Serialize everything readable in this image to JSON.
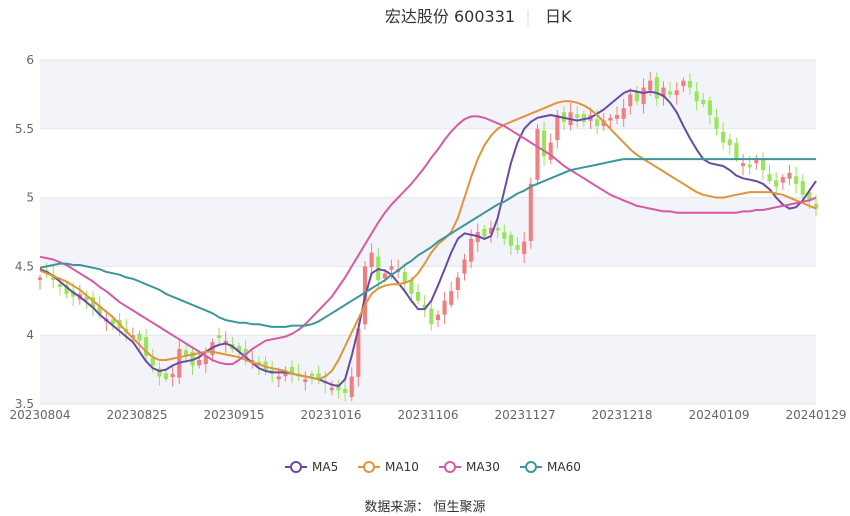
{
  "header": {
    "title": "宏达股份 600331",
    "period": "日K"
  },
  "legend": [
    {
      "name": "MA5",
      "color": "#6a4aa5"
    },
    {
      "name": "MA10",
      "color": "#e0953a"
    },
    {
      "name": "MA30",
      "color": "#d65aa6"
    },
    {
      "name": "MA60",
      "color": "#3d969a"
    }
  ],
  "footer": {
    "source": "数据来源：  恒生聚源"
  },
  "colors": {
    "up": "#f08080",
    "down": "#98e45a",
    "band": "#f3f4f9",
    "grid": "#e6e6e6"
  },
  "chart_data": {
    "type": "candlestick",
    "title": "宏达股份 600331",
    "ylim": [
      3.5,
      6
    ],
    "y_ticks": [
      3.5,
      4,
      4.5,
      5,
      5.5,
      6
    ],
    "x_tick_labels": [
      "20230804",
      "20230825",
      "20230915",
      "20231016",
      "20231106",
      "20231127",
      "20231218",
      "20240109",
      "20240129"
    ],
    "n_days": 118,
    "candle_close": [
      4.42,
      4.45,
      4.4,
      4.35,
      4.3,
      4.28,
      4.3,
      4.25,
      4.2,
      4.15,
      4.12,
      4.08,
      4.05,
      4.02,
      4.0,
      3.96,
      3.85,
      3.78,
      3.7,
      3.68,
      3.72,
      3.9,
      3.85,
      3.78,
      3.82,
      3.85,
      3.95,
      3.98,
      3.96,
      3.9,
      3.88,
      3.84,
      3.82,
      3.78,
      3.74,
      3.72,
      3.7,
      3.74,
      3.72,
      3.7,
      3.68,
      3.7,
      3.68,
      3.65,
      3.62,
      3.6,
      3.58,
      3.7,
      4.05,
      4.5,
      4.6,
      4.4,
      4.45,
      4.5,
      4.48,
      4.38,
      4.3,
      4.25,
      4.2,
      4.08,
      4.15,
      4.25,
      4.32,
      4.42,
      4.55,
      4.7,
      4.75,
      4.72,
      4.78,
      4.76,
      4.7,
      4.65,
      4.62,
      4.68,
      5.1,
      5.5,
      5.3,
      5.4,
      5.6,
      5.55,
      5.62,
      5.58,
      5.55,
      5.6,
      5.52,
      5.56,
      5.58,
      5.6,
      5.65,
      5.75,
      5.7,
      5.8,
      5.85,
      5.72,
      5.8,
      5.75,
      5.78,
      5.85,
      5.8,
      5.7,
      5.68,
      5.6,
      5.5,
      5.4,
      5.38,
      5.28,
      5.25,
      5.22,
      5.28,
      5.2,
      5.12,
      5.08,
      5.15,
      5.18,
      5.1,
      5.02,
      4.98,
      4.92
    ],
    "series": [
      {
        "name": "MA5",
        "values": [
          4.48,
          4.46,
          4.43,
          4.39,
          4.35,
          4.31,
          4.28,
          4.24,
          4.2,
          4.15,
          4.11,
          4.07,
          4.03,
          3.99,
          3.95,
          3.88,
          3.81,
          3.76,
          3.74,
          3.75,
          3.78,
          3.8,
          3.81,
          3.82,
          3.84,
          3.88,
          3.91,
          3.93,
          3.94,
          3.92,
          3.88,
          3.84,
          3.8,
          3.76,
          3.74,
          3.73,
          3.73,
          3.73,
          3.72,
          3.71,
          3.7,
          3.69,
          3.68,
          3.66,
          3.64,
          3.63,
          3.68,
          3.85,
          4.05,
          4.28,
          4.45,
          4.48,
          4.47,
          4.44,
          4.38,
          4.32,
          4.25,
          4.19,
          4.19,
          4.25,
          4.36,
          4.48,
          4.6,
          4.7,
          4.74,
          4.73,
          4.72,
          4.7,
          4.72,
          4.85,
          5.05,
          5.25,
          5.4,
          5.5,
          5.55,
          5.58,
          5.59,
          5.6,
          5.59,
          5.58,
          5.57,
          5.56,
          5.57,
          5.58,
          5.61,
          5.64,
          5.68,
          5.72,
          5.76,
          5.78,
          5.77,
          5.76,
          5.77,
          5.76,
          5.74,
          5.69,
          5.62,
          5.52,
          5.43,
          5.35,
          5.28,
          5.25,
          5.24,
          5.23,
          5.2,
          5.16,
          5.14,
          5.13,
          5.12,
          5.1,
          5.06,
          5.0,
          4.95,
          4.92,
          4.93,
          4.98,
          5.05,
          5.12
        ]
      },
      {
        "name": "MA10",
        "values": [
          4.47,
          4.45,
          4.43,
          4.41,
          4.39,
          4.36,
          4.33,
          4.29,
          4.25,
          4.21,
          4.17,
          4.13,
          4.08,
          4.03,
          3.98,
          3.93,
          3.88,
          3.84,
          3.82,
          3.82,
          3.83,
          3.84,
          3.85,
          3.86,
          3.87,
          3.88,
          3.88,
          3.87,
          3.86,
          3.85,
          3.84,
          3.82,
          3.8,
          3.79,
          3.77,
          3.76,
          3.75,
          3.74,
          3.72,
          3.71,
          3.7,
          3.69,
          3.68,
          3.7,
          3.74,
          3.82,
          3.92,
          4.02,
          4.12,
          4.22,
          4.3,
          4.34,
          4.36,
          4.37,
          4.37,
          4.38,
          4.4,
          4.45,
          4.52,
          4.6,
          4.66,
          4.7,
          4.75,
          4.85,
          5.0,
          5.15,
          5.28,
          5.38,
          5.45,
          5.5,
          5.53,
          5.55,
          5.57,
          5.59,
          5.61,
          5.63,
          5.65,
          5.67,
          5.69,
          5.7,
          5.7,
          5.69,
          5.67,
          5.64,
          5.6,
          5.55,
          5.5,
          5.45,
          5.4,
          5.35,
          5.31,
          5.28,
          5.25,
          5.22,
          5.19,
          5.16,
          5.13,
          5.1,
          5.07,
          5.04,
          5.02,
          5.01,
          5.0,
          5.0,
          5.01,
          5.02,
          5.03,
          5.04,
          5.04,
          5.04,
          5.04,
          5.03,
          5.02,
          5.0,
          4.98,
          4.96,
          4.94,
          4.92
        ]
      },
      {
        "name": "MA30",
        "values": [
          4.57,
          4.56,
          4.55,
          4.53,
          4.51,
          4.48,
          4.45,
          4.42,
          4.39,
          4.35,
          4.32,
          4.28,
          4.24,
          4.21,
          4.18,
          4.15,
          4.12,
          4.09,
          4.06,
          4.03,
          4.0,
          3.97,
          3.94,
          3.91,
          3.88,
          3.85,
          3.82,
          3.8,
          3.79,
          3.79,
          3.82,
          3.86,
          3.9,
          3.93,
          3.96,
          3.97,
          3.98,
          3.99,
          4.01,
          4.04,
          4.08,
          4.13,
          4.18,
          4.23,
          4.28,
          4.35,
          4.42,
          4.5,
          4.58,
          4.66,
          4.74,
          4.82,
          4.89,
          4.95,
          5.0,
          5.05,
          5.1,
          5.16,
          5.22,
          5.29,
          5.35,
          5.42,
          5.48,
          5.53,
          5.57,
          5.59,
          5.59,
          5.58,
          5.56,
          5.54,
          5.52,
          5.49,
          5.46,
          5.43,
          5.4,
          5.37,
          5.34,
          5.31,
          5.27,
          5.23,
          5.2,
          5.17,
          5.14,
          5.11,
          5.08,
          5.05,
          5.02,
          5.0,
          4.98,
          4.96,
          4.94,
          4.93,
          4.92,
          4.91,
          4.9,
          4.9,
          4.89,
          4.89,
          4.89,
          4.89,
          4.89,
          4.89,
          4.89,
          4.89,
          4.89,
          4.89,
          4.9,
          4.9,
          4.91,
          4.91,
          4.92,
          4.93,
          4.94,
          4.95,
          4.96,
          4.97,
          4.98,
          5.0
        ]
      },
      {
        "name": "MA60",
        "values": [
          4.49,
          4.5,
          4.51,
          4.52,
          4.52,
          4.51,
          4.51,
          4.5,
          4.49,
          4.48,
          4.46,
          4.45,
          4.44,
          4.42,
          4.41,
          4.39,
          4.37,
          4.35,
          4.33,
          4.3,
          4.28,
          4.26,
          4.24,
          4.22,
          4.2,
          4.18,
          4.16,
          4.13,
          4.11,
          4.1,
          4.09,
          4.09,
          4.08,
          4.08,
          4.07,
          4.06,
          4.06,
          4.06,
          4.07,
          4.07,
          4.07,
          4.08,
          4.1,
          4.13,
          4.16,
          4.19,
          4.22,
          4.25,
          4.28,
          4.31,
          4.34,
          4.37,
          4.4,
          4.44,
          4.47,
          4.51,
          4.54,
          4.58,
          4.61,
          4.64,
          4.68,
          4.71,
          4.74,
          4.77,
          4.8,
          4.83,
          4.86,
          4.89,
          4.92,
          4.95,
          4.97,
          5.0,
          5.03,
          5.05,
          5.08,
          5.1,
          5.12,
          5.14,
          5.16,
          5.18,
          5.2,
          5.21,
          5.22,
          5.23,
          5.24,
          5.25,
          5.26,
          5.27,
          5.28,
          5.28,
          5.28,
          5.28,
          5.28,
          5.28,
          5.28,
          5.28,
          5.28,
          5.28,
          5.28,
          5.28,
          5.28,
          5.28,
          5.28,
          5.28,
          5.28,
          5.28,
          5.28,
          5.28,
          5.28,
          5.28,
          5.28,
          5.28,
          5.28,
          5.28,
          5.28,
          5.28,
          5.28,
          5.28
        ]
      }
    ],
    "grid": true,
    "legend_position": "bottom"
  }
}
